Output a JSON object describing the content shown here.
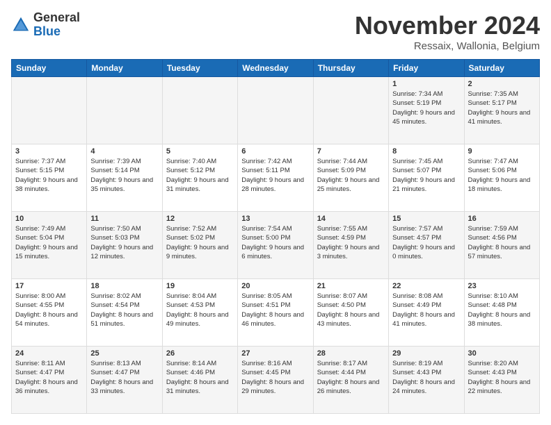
{
  "logo": {
    "general": "General",
    "blue": "Blue"
  },
  "header": {
    "month": "November 2024",
    "location": "Ressaix, Wallonia, Belgium"
  },
  "weekdays": [
    "Sunday",
    "Monday",
    "Tuesday",
    "Wednesday",
    "Thursday",
    "Friday",
    "Saturday"
  ],
  "weeks": [
    [
      {
        "day": "",
        "info": ""
      },
      {
        "day": "",
        "info": ""
      },
      {
        "day": "",
        "info": ""
      },
      {
        "day": "",
        "info": ""
      },
      {
        "day": "",
        "info": ""
      },
      {
        "day": "1",
        "info": "Sunrise: 7:34 AM\nSunset: 5:19 PM\nDaylight: 9 hours and 45 minutes."
      },
      {
        "day": "2",
        "info": "Sunrise: 7:35 AM\nSunset: 5:17 PM\nDaylight: 9 hours and 41 minutes."
      }
    ],
    [
      {
        "day": "3",
        "info": "Sunrise: 7:37 AM\nSunset: 5:15 PM\nDaylight: 9 hours and 38 minutes."
      },
      {
        "day": "4",
        "info": "Sunrise: 7:39 AM\nSunset: 5:14 PM\nDaylight: 9 hours and 35 minutes."
      },
      {
        "day": "5",
        "info": "Sunrise: 7:40 AM\nSunset: 5:12 PM\nDaylight: 9 hours and 31 minutes."
      },
      {
        "day": "6",
        "info": "Sunrise: 7:42 AM\nSunset: 5:11 PM\nDaylight: 9 hours and 28 minutes."
      },
      {
        "day": "7",
        "info": "Sunrise: 7:44 AM\nSunset: 5:09 PM\nDaylight: 9 hours and 25 minutes."
      },
      {
        "day": "8",
        "info": "Sunrise: 7:45 AM\nSunset: 5:07 PM\nDaylight: 9 hours and 21 minutes."
      },
      {
        "day": "9",
        "info": "Sunrise: 7:47 AM\nSunset: 5:06 PM\nDaylight: 9 hours and 18 minutes."
      }
    ],
    [
      {
        "day": "10",
        "info": "Sunrise: 7:49 AM\nSunset: 5:04 PM\nDaylight: 9 hours and 15 minutes."
      },
      {
        "day": "11",
        "info": "Sunrise: 7:50 AM\nSunset: 5:03 PM\nDaylight: 9 hours and 12 minutes."
      },
      {
        "day": "12",
        "info": "Sunrise: 7:52 AM\nSunset: 5:02 PM\nDaylight: 9 hours and 9 minutes."
      },
      {
        "day": "13",
        "info": "Sunrise: 7:54 AM\nSunset: 5:00 PM\nDaylight: 9 hours and 6 minutes."
      },
      {
        "day": "14",
        "info": "Sunrise: 7:55 AM\nSunset: 4:59 PM\nDaylight: 9 hours and 3 minutes."
      },
      {
        "day": "15",
        "info": "Sunrise: 7:57 AM\nSunset: 4:57 PM\nDaylight: 9 hours and 0 minutes."
      },
      {
        "day": "16",
        "info": "Sunrise: 7:59 AM\nSunset: 4:56 PM\nDaylight: 8 hours and 57 minutes."
      }
    ],
    [
      {
        "day": "17",
        "info": "Sunrise: 8:00 AM\nSunset: 4:55 PM\nDaylight: 8 hours and 54 minutes."
      },
      {
        "day": "18",
        "info": "Sunrise: 8:02 AM\nSunset: 4:54 PM\nDaylight: 8 hours and 51 minutes."
      },
      {
        "day": "19",
        "info": "Sunrise: 8:04 AM\nSunset: 4:53 PM\nDaylight: 8 hours and 49 minutes."
      },
      {
        "day": "20",
        "info": "Sunrise: 8:05 AM\nSunset: 4:51 PM\nDaylight: 8 hours and 46 minutes."
      },
      {
        "day": "21",
        "info": "Sunrise: 8:07 AM\nSunset: 4:50 PM\nDaylight: 8 hours and 43 minutes."
      },
      {
        "day": "22",
        "info": "Sunrise: 8:08 AM\nSunset: 4:49 PM\nDaylight: 8 hours and 41 minutes."
      },
      {
        "day": "23",
        "info": "Sunrise: 8:10 AM\nSunset: 4:48 PM\nDaylight: 8 hours and 38 minutes."
      }
    ],
    [
      {
        "day": "24",
        "info": "Sunrise: 8:11 AM\nSunset: 4:47 PM\nDaylight: 8 hours and 36 minutes."
      },
      {
        "day": "25",
        "info": "Sunrise: 8:13 AM\nSunset: 4:47 PM\nDaylight: 8 hours and 33 minutes."
      },
      {
        "day": "26",
        "info": "Sunrise: 8:14 AM\nSunset: 4:46 PM\nDaylight: 8 hours and 31 minutes."
      },
      {
        "day": "27",
        "info": "Sunrise: 8:16 AM\nSunset: 4:45 PM\nDaylight: 8 hours and 29 minutes."
      },
      {
        "day": "28",
        "info": "Sunrise: 8:17 AM\nSunset: 4:44 PM\nDaylight: 8 hours and 26 minutes."
      },
      {
        "day": "29",
        "info": "Sunrise: 8:19 AM\nSunset: 4:43 PM\nDaylight: 8 hours and 24 minutes."
      },
      {
        "day": "30",
        "info": "Sunrise: 8:20 AM\nSunset: 4:43 PM\nDaylight: 8 hours and 22 minutes."
      }
    ]
  ]
}
